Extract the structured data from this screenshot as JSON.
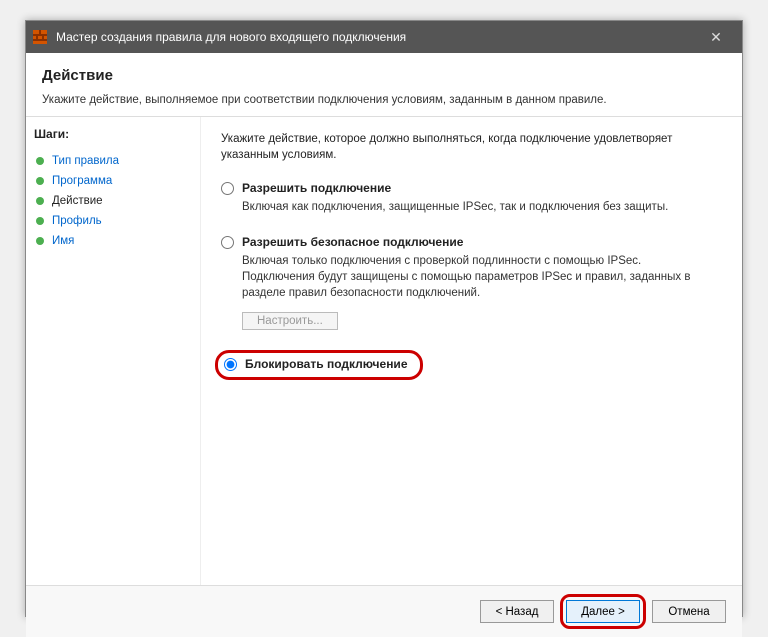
{
  "titlebar": {
    "title": "Мастер создания правила для нового входящего подключения"
  },
  "header": {
    "title": "Действие",
    "subtitle": "Укажите действие, выполняемое при соответствии подключения условиям, заданным в данном правиле."
  },
  "sidebar": {
    "heading": "Шаги:",
    "steps": [
      {
        "label": "Тип правила",
        "current": false
      },
      {
        "label": "Программа",
        "current": false
      },
      {
        "label": "Действие",
        "current": true
      },
      {
        "label": "Профиль",
        "current": false
      },
      {
        "label": "Имя",
        "current": false
      }
    ]
  },
  "content": {
    "intro": "Укажите действие, которое должно выполняться, когда подключение удовлетворяет указанным условиям.",
    "options": [
      {
        "label": "Разрешить подключение",
        "desc": "Включая как подключения, защищенные IPSec, так и подключения без защиты.",
        "selected": false
      },
      {
        "label": "Разрешить безопасное подключение",
        "desc": "Включая только подключения с проверкой подлинности с помощью IPSec. Подключения будут защищены с помощью параметров IPSec и правил, заданных в разделе правил безопасности подключений.",
        "selected": false,
        "configure_label": "Настроить..."
      },
      {
        "label": "Блокировать подключение",
        "selected": true
      }
    ]
  },
  "footer": {
    "back": "< Назад",
    "next": "Далее >",
    "cancel": "Отмена"
  }
}
